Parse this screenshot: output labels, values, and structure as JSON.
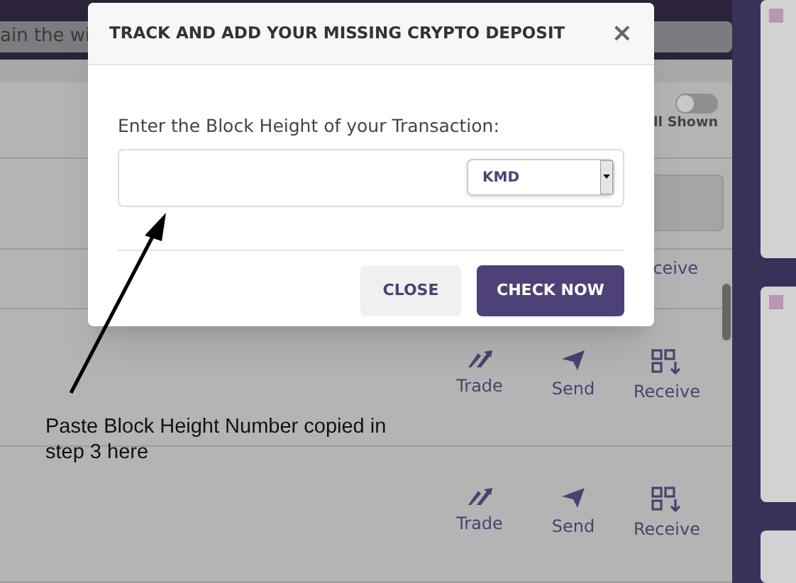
{
  "page": {
    "banner_text": "ain the wi",
    "toggle": {
      "label": "ll Shown",
      "on": false
    },
    "partial_action": "ceive",
    "rows": [
      {
        "actions": [
          {
            "kind": "trade",
            "label": "Trade"
          },
          {
            "kind": "send",
            "label": "Send"
          },
          {
            "kind": "receive",
            "label": "Receive"
          }
        ]
      },
      {
        "actions": [
          {
            "kind": "trade",
            "label": "Trade"
          },
          {
            "kind": "send",
            "label": "Send"
          },
          {
            "kind": "receive",
            "label": "Receive"
          }
        ]
      }
    ]
  },
  "modal": {
    "title": "TRACK AND ADD YOUR MISSING CRYPTO DEPOSIT",
    "close_icon": "×",
    "field_label": "Enter the Block Height of your Transaction:",
    "select": {
      "value": "KMD"
    },
    "buttons": [
      {
        "kind": "secondary",
        "label": "CLOSE"
      },
      {
        "kind": "primary",
        "label": "CHECK NOW"
      }
    ]
  },
  "annotation": {
    "text": "Paste Block Height Number copied in step 3 here"
  }
}
